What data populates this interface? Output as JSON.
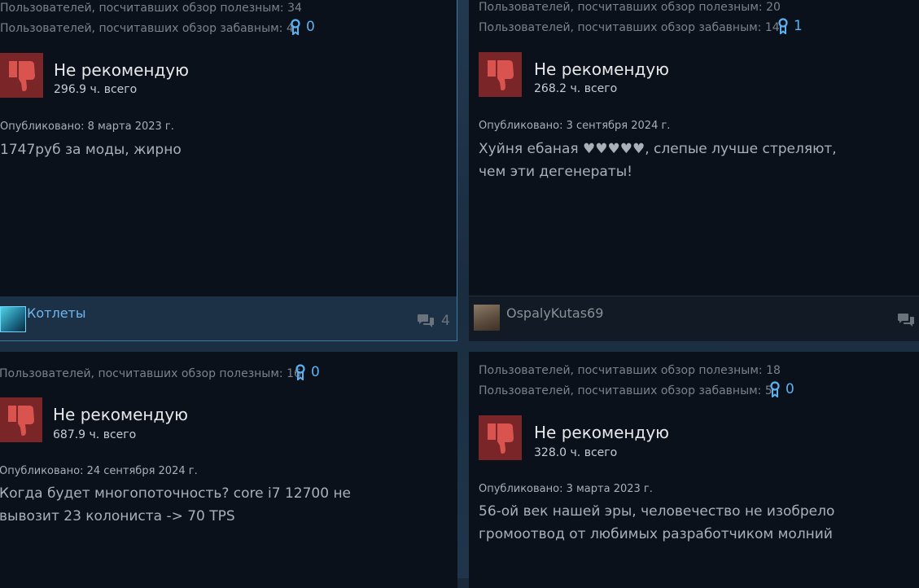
{
  "reviews": [
    {
      "helpful": "Пользователей, посчитавших обзор полезным: 34",
      "funny": "Пользователей, посчитавших обзор забавным: 4",
      "awards": "0",
      "recommendation": "Не рекомендую",
      "hours": "296.9 ч. всего",
      "posted": "Опубликовано: 8 марта 2023 г.",
      "text": "1747руб за моды, жирно",
      "author": "Котлеты",
      "comments": "4"
    },
    {
      "helpful": "Пользователей, посчитавших обзор полезным: 20",
      "funny": "Пользователей, посчитавших обзор забавным: 14",
      "awards": "1",
      "recommendation": "Не рекомендую",
      "hours": "268.2 ч. всего",
      "posted": "Опубликовано: 3 сентября 2024 г.",
      "text": "Хуйня ебаная ♥♥♥♥♥, слепые лучше стреляют, чем эти дегенераты!",
      "author": "OspalyKutas69",
      "comments": ""
    },
    {
      "helpful": "Пользователей, посчитавших обзор полезным: 16",
      "awards": "0",
      "recommendation": "Не рекомендую",
      "hours": "687.9 ч. всего",
      "posted": "Опубликовано: 24 сентября 2024 г.",
      "text": "Когда будет многопоточность? core i7 12700 не вывозит 23 колониста -> 70 TPS"
    },
    {
      "helpful": "Пользователей, посчитавших обзор полезным: 18",
      "funny": "Пользователей, посчитавших обзор забавным: 5",
      "awards": "0",
      "recommendation": "Не рекомендую",
      "hours": "328.0 ч. всего",
      "posted": "Опубликовано: 3 марта 2023 г.",
      "text": "56-ой век нашей эры, человечество не изобрело громоотвод от любимых разработчиком молний"
    }
  ],
  "colors": {
    "card_bg": "#0b111b",
    "thumb_bg": "#7a2628",
    "award": "#5cb1f0",
    "author_link": "#6fb6f0",
    "author_plain": "#8a9097",
    "selected_border": "#3a79a8"
  },
  "icons": {
    "thumbs_down": "thumbs-down-icon",
    "award": "award-ribbon-icon",
    "comments": "comments-icon"
  }
}
